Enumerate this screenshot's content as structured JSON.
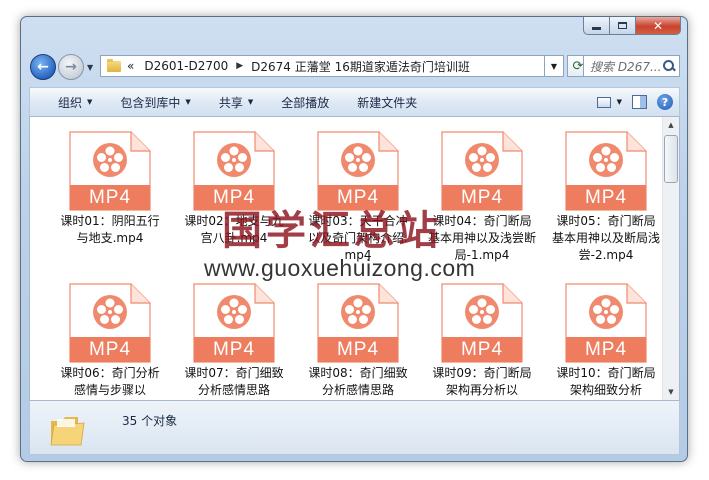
{
  "address_bar": {
    "overflow": "«",
    "crumbs": [
      "D2601-D2700",
      "D2674 正藩堂 16期道家遁法奇门培训班"
    ]
  },
  "search": {
    "placeholder": "搜索 D267..."
  },
  "toolbar": {
    "organize": "组织",
    "include_in_library": "包含到库中",
    "share": "共享",
    "play_all": "全部播放",
    "new_folder": "新建文件夹"
  },
  "files": [
    {
      "badge": "MP4",
      "name": "课时01：阴阳五行与地支.mp4"
    },
    {
      "badge": "MP4",
      "name": "课时02：地支与九宫八卦.mp4"
    },
    {
      "badge": "MP4",
      "name": "课时03：天干合冲以及奇门架构介绍.mp4"
    },
    {
      "badge": "MP4",
      "name": "课时04：奇门断局基本用神以及浅尝断局-1.mp4"
    },
    {
      "badge": "MP4",
      "name": "课时05：奇门断局基本用神以及断局浅尝-2.mp4"
    },
    {
      "badge": "MP4",
      "name": "课时06：奇门分析感情与步骤以"
    },
    {
      "badge": "MP4",
      "name": "课时07：奇门细致分析感情思路"
    },
    {
      "badge": "MP4",
      "name": "课时08：奇门细致分析感情思路"
    },
    {
      "badge": "MP4",
      "name": "课时09：奇门断局架构再分析以"
    },
    {
      "badge": "MP4",
      "name": "课时10：奇门断局架构细致分析"
    }
  ],
  "status": {
    "count": "35 个对象"
  },
  "watermark": {
    "text_cn": "国学汇总站",
    "url": "www.guoxuehuizong.com"
  },
  "colors": {
    "mp4_accent": "#f08a6e",
    "mp4_band": "#ee7d5f"
  }
}
